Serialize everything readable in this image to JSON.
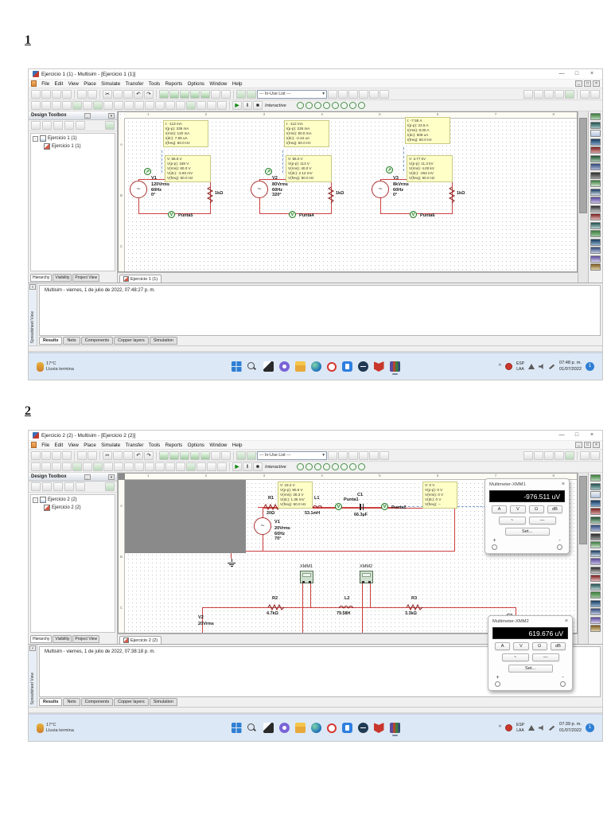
{
  "page": {
    "sec1": "1",
    "sec2": "2"
  },
  "icons": {
    "minimize": "—",
    "restore": "□",
    "close": "×",
    "mdi_minimize": "_",
    "mdi_restore": "□",
    "mdi_close": "×",
    "dropdown": "▾",
    "cut": "✂",
    "undo": "↶",
    "redo": "↷",
    "play": "▶",
    "pause": "‖",
    "stop": "■",
    "sine": "~",
    "dc": "—",
    "tray_chevron": "^",
    "probe_v": "V",
    "probe_a": "↗",
    "tree_minus": "-"
  },
  "shared": {
    "menu": [
      "File",
      "Edit",
      "View",
      "Place",
      "Simulate",
      "Transfer",
      "Tools",
      "Reports",
      "Options",
      "Window",
      "Help"
    ],
    "in_use": "--- In-Use List ---",
    "interactive": "Interactive",
    "toolbox_title": "Design Toolbox",
    "toolbox_tabs": [
      "Hierarchy",
      "Visibility",
      "Project View"
    ],
    "bottom_tabs": [
      "Results",
      "Nets",
      "Components",
      "Copper layers",
      "Simulation"
    ],
    "spreadsheet_label": "Spreadsheet View",
    "ruler_h": [
      "1",
      "2",
      "3",
      "4",
      "5",
      "6",
      "7",
      "8"
    ],
    "ruler_v": [
      "A",
      "B",
      "C"
    ],
    "weather": {
      "temp": "17°C",
      "desc": "Lluvia termina"
    },
    "lang": "ESP\nLAA"
  },
  "win1": {
    "title": "Ejercicio 1 (1) - Multisim - [Ejercicio 1 (1)]",
    "tree": {
      "root": "Ejercicio 1 (1)",
      "child": "Ejercicio 1 (1)"
    },
    "sheet_tab": "Ejercicio 1 (1)",
    "log": "Multisim  -  viernes, 1 de julio de 2022, 07:48:27 p. m.",
    "time": "07:48 p. m.",
    "date": "01/07/2022",
    "badge": "1",
    "circuits": [
      {
        "name": "V1",
        "specs": "120Vrms\n60Hz\n0°",
        "resistor": "1kΩ",
        "probe": "Punta5",
        "inote": "I: -113 mA\nI(p-p): 339 mA\nI(rms): 120 mA\nI(dc): 7.59 uA\nI(freq): 60.0 Hz",
        "vnote": "V: 56.6 V\nV(p-p): 169 V\nV(rms): 60.0 V\nV(dc): -3.60 mV\nV(freq): 60.0 Hz"
      },
      {
        "name": "V2",
        "specs": "80Vrms\n60Hz\n320°",
        "resistor": "1kΩ",
        "probe": "Punta4",
        "inote": "I: -112 mA\nI(p-p): 226 mA\nI(rms): 80.0 mA\nI(dc): -4.24 uA\nI(freq): 60.0 Hz",
        "vnote": "V: 56.0 V\nV(p-p): 113 V\nV(rms): 40.0 V\nV(dc): 2.12 mV\nV(freq): 60.0 Hz"
      },
      {
        "name": "V3",
        "specs": "8kVrms\n60Hz\n0°",
        "resistor": "1kΩ",
        "probe": "Punta6",
        "inote": "I: -7.55 A\nI(p-p): 22.6 A\nI(rms): 8.00 A\nI(dc): 508 uA\nI(freq): 60.0 Hz",
        "vnote": "V: 3.77 kV\nV(p-p): 11.3 kV\nV(rms): 4.00 kV\nV(dc): -253 mV\nV(freq): 60.0 Hz"
      }
    ]
  },
  "win2": {
    "title": "Ejercicio 2 (2) - Multisim - [Ejercicio 2 (2)]",
    "tree": {
      "root": "Ejercicio 2 (2)",
      "child": "Ejercicio 2 (2)"
    },
    "sheet_tab": "Ejercicio 2 (2)",
    "log": "Multisim  -  viernes, 1 de julio de 2022, 07:38:18 p. m.",
    "time": "07:39 p. m.",
    "date": "01/07/2022",
    "badge": "1",
    "notes": {
      "left": "V: 19.2 V\nV(p-p): 80.5 V\nV(rms): 28.3 V\nV(dc): 1.36 mV\nV(freq): 60.0 Hz",
      "right": "V: 0 V\nV(p-p): 0 V\nV(rms): 0 V\nV(dc): 0 V\nV(freq): --"
    },
    "comp": {
      "v1": {
        "name": "V1",
        "specs": "20Vrms\n60Hz\n70°"
      },
      "r1": {
        "name": "R1",
        "value": "20Ω"
      },
      "l1": {
        "name": "L1",
        "value": "53.1mH"
      },
      "c1": {
        "name": "C1",
        "value": "66.3µF"
      },
      "p1": "Punta1",
      "p2": "Punta2",
      "xmm1": "XMM1",
      "xmm2": "XMM2",
      "r2": {
        "name": "R2",
        "value": "4.7kΩ"
      },
      "l2": {
        "name": "L2",
        "value": "79.58H"
      },
      "r3": {
        "name": "R3",
        "value": "3.3kΩ"
      },
      "v2": {
        "name": "V2",
        "specs": "20Vrms"
      },
      "c2": "C2"
    },
    "mm": [
      {
        "title": "Multimeter-XMM1",
        "value": "-976.511 uV",
        "buttons": [
          "A",
          "V",
          "Ω",
          "dB"
        ],
        "set": "Set...",
        "plus": "+",
        "minus": "-"
      },
      {
        "title": "Multimeter-XMM2",
        "value": "619.676 uV",
        "buttons": [
          "A",
          "V",
          "Ω",
          "dB"
        ],
        "set": "Set...",
        "plus": "+",
        "minus": "-"
      }
    ]
  }
}
